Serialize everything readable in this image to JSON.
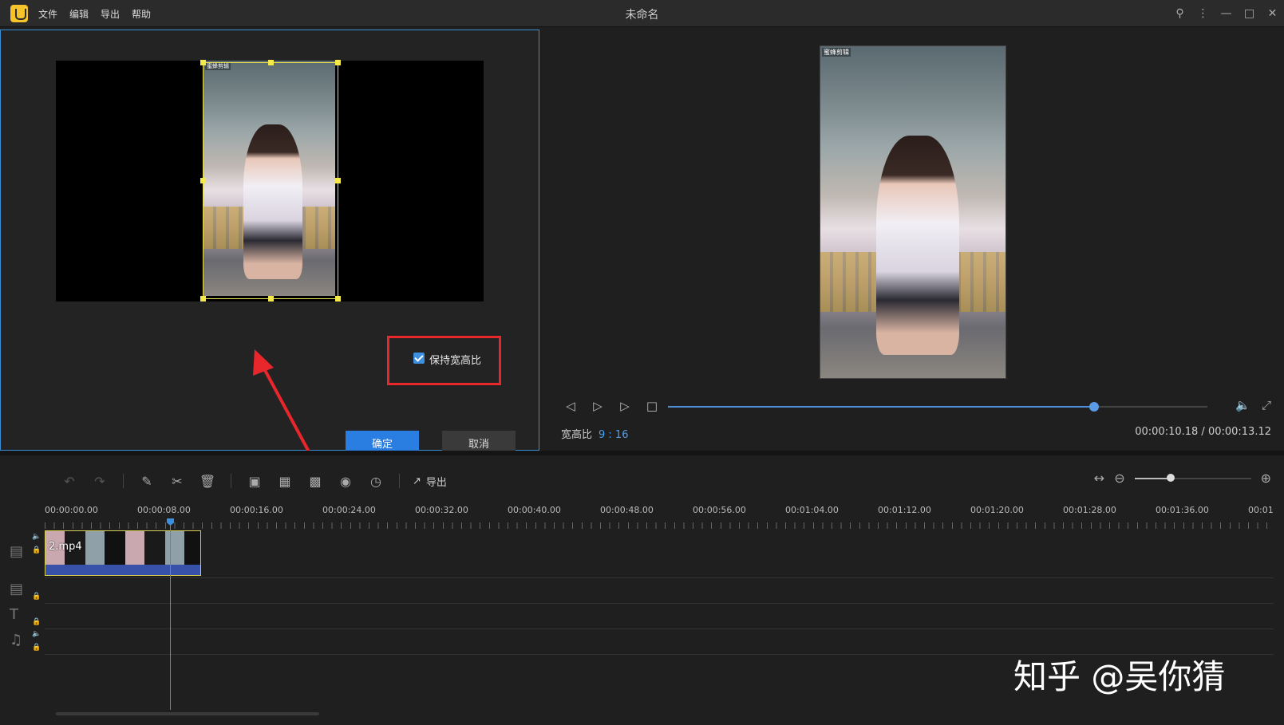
{
  "app": {
    "title": "未命名",
    "menu": [
      "文件",
      "编辑",
      "导出",
      "帮助"
    ]
  },
  "window_controls": [
    "user-icon",
    "more-icon",
    "minimize-icon",
    "maximize-icon",
    "close-icon"
  ],
  "crop_dialog": {
    "keep_ratio_label": "保持宽高比",
    "keep_ratio_checked": true,
    "confirm_label": "确定",
    "cancel_label": "取消",
    "clip_watermark": "蜜蜂剪辑"
  },
  "preview": {
    "watermark": "蜜蜂剪辑",
    "aspect_label": "宽高比",
    "aspect_value": "9 : 16",
    "timecode": "00:00:10.18 / 00:00:13.12",
    "progress": 0.79
  },
  "toolbar": {
    "export_label": "导出",
    "zoom_level": 0.3
  },
  "timeline": {
    "ruler": [
      "00:00:00.00",
      "00:00:08.00",
      "00:00:16.00",
      "00:00:24.00",
      "00:00:32.00",
      "00:00:40.00",
      "00:00:48.00",
      "00:00:56.00",
      "00:01:04.00",
      "00:01:12.00",
      "00:01:20.00",
      "00:01:28.00",
      "00:01:36.00",
      "00:01"
    ],
    "clip_name": "2.mp4"
  },
  "overlay_watermark": "知乎 @吴你猜",
  "colors": {
    "accent": "#2a7ee2",
    "highlight_box": "#e8272d",
    "crop_handle": "#f4e94a",
    "background": "#1f1f1f"
  }
}
